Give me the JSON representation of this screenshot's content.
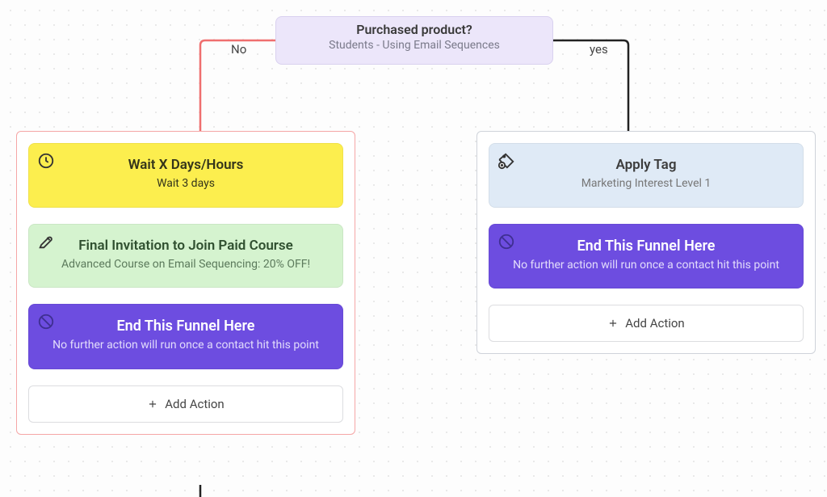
{
  "decision": {
    "title": "Purchased product?",
    "subtitle": "Students - Using Email Sequences"
  },
  "branches": {
    "no_label": "No",
    "yes_label": "yes"
  },
  "left_column": {
    "wait": {
      "title": "Wait X Days/Hours",
      "subtitle": "Wait 3 days"
    },
    "email": {
      "title": "Final Invitation to Join Paid Course",
      "subtitle": "Advanced Course on Email Sequencing: 20% OFF!"
    },
    "end": {
      "title": "End This Funnel Here",
      "subtitle": "No further action will run once a contact hit this point"
    },
    "add_action": "Add Action"
  },
  "right_column": {
    "tag": {
      "title": "Apply Tag",
      "subtitle": "Marketing Interest Level 1"
    },
    "end": {
      "title": "End This Funnel Here",
      "subtitle": "No further action will run once a contact hit this point"
    },
    "add_action": "Add Action"
  },
  "colors": {
    "wait": "#fcee4e",
    "email": "#d5f3cf",
    "end": "#6d4de0",
    "tag": "#dfeaf6",
    "left_border": "#f5a6a6",
    "right_border": "#cfd3da"
  }
}
